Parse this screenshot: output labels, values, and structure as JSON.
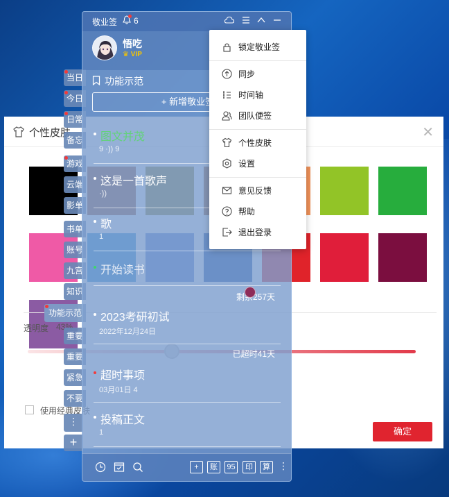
{
  "skin_dialog": {
    "title": "个性皮肤",
    "swatches": [
      "#000000",
      "#9b5a3f",
      "#8f8536",
      "#9c5c2e",
      "#f0925a",
      "#92c427",
      "#27ad3d",
      "#ef5aa6",
      "#2f8fd8",
      "#587fd0",
      "#1b4fa8",
      "#e0232a",
      "#e01e3a",
      "#7b0e3f",
      "#8b5ba3"
    ],
    "selected_swatch": 9,
    "opacity_label": "透明度",
    "opacity_value": "43%",
    "opacity_level": 0.43,
    "classic_label": "使用经典皮肤",
    "confirm_label": "确定"
  },
  "side_tags": [
    {
      "label": "当日",
      "dot": true
    },
    {
      "label": "今日",
      "dot": true
    },
    {
      "label": "日常",
      "dot": true
    },
    {
      "label": "备忘",
      "dot": false
    },
    {
      "label": "游戏",
      "dot": true
    },
    {
      "label": "云端",
      "dot": false
    },
    {
      "label": "影单",
      "dot": false
    },
    {
      "label": "书单",
      "dot": false
    },
    {
      "label": "账号",
      "dot": false
    },
    {
      "label": "九宫",
      "dot": false
    },
    {
      "label": "知识",
      "dot": false
    },
    {
      "label": "功能示范",
      "dot": true
    },
    {
      "label": "重要",
      "dot": false
    },
    {
      "label": "重要",
      "dot": false
    },
    {
      "label": "紧急",
      "dot": false
    },
    {
      "label": "不要",
      "dot": false
    }
  ],
  "panel": {
    "app_name": "敬业签",
    "notify_count": "6",
    "username": "悟吃",
    "vip": "VIP",
    "section_title": "功能示范",
    "new_button": "+ 新增敬业签",
    "notes": [
      {
        "title": "图文并茂",
        "meta": "9 ·)) 9",
        "title_color": "#62d27a",
        "right": ""
      },
      {
        "title": "这是一首歌声",
        "meta": "·))",
        "title_color": "#ffffff",
        "right": ""
      },
      {
        "title": "歌",
        "meta": "1",
        "title_color": "#ffffff",
        "right": ""
      },
      {
        "title": "开始读书",
        "meta": "",
        "title_color": "#e6ecf6",
        "right": "剩余257天"
      },
      {
        "title": "2023考研初试",
        "meta": "2022年12月24日",
        "title_color": "#ffffff",
        "right": "已超时41天"
      },
      {
        "title": "超时事项",
        "meta": "03月01日   4",
        "title_color": "#ffffff",
        "right": ""
      },
      {
        "title": "投稿正文",
        "meta": "1",
        "title_color": "#ffffff",
        "right": ""
      }
    ],
    "bottom_buttons": [
      "账",
      "95",
      "印",
      "算"
    ]
  },
  "menu": {
    "items": [
      {
        "label": "锁定敬业签",
        "icon": "lock-icon"
      },
      {
        "label": "同步",
        "icon": "sync-icon"
      },
      {
        "label": "时间轴",
        "icon": "timeline-icon"
      },
      {
        "label": "团队便签",
        "icon": "team-icon"
      },
      {
        "label": "个性皮肤",
        "icon": "shirt-icon"
      },
      {
        "label": "设置",
        "icon": "settings-icon"
      },
      {
        "label": "意见反馈",
        "icon": "feedback-icon"
      },
      {
        "label": "帮助",
        "icon": "help-icon"
      },
      {
        "label": "退出登录",
        "icon": "logout-icon"
      }
    ]
  }
}
